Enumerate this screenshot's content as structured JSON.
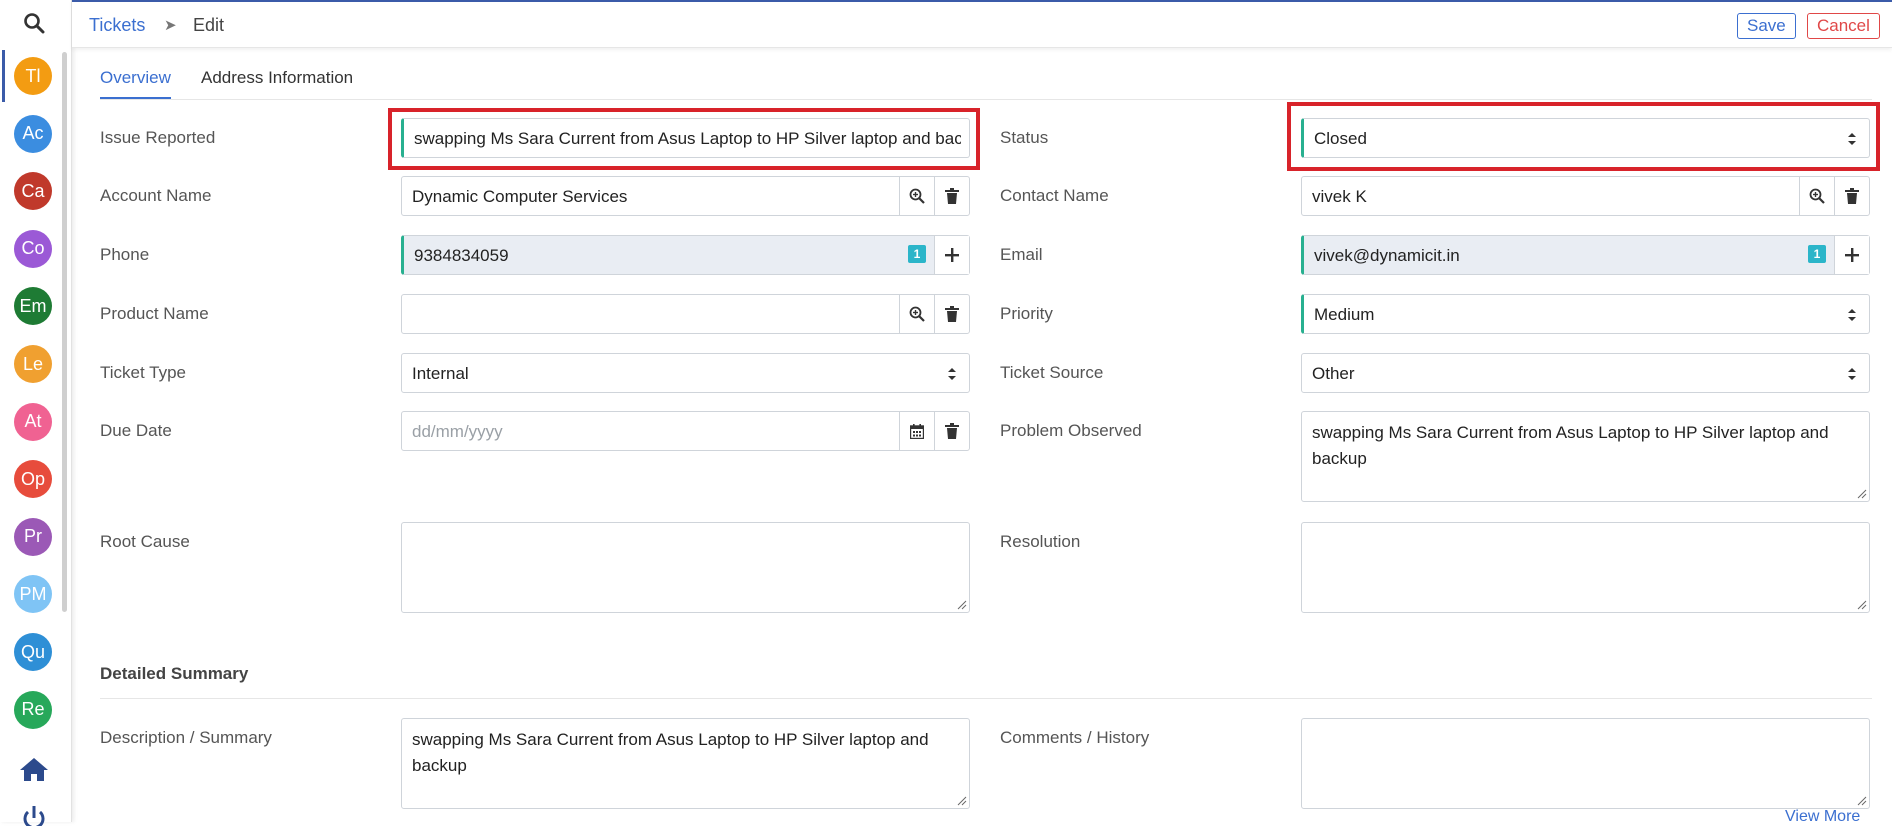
{
  "colors": {
    "accent": "#3b6fd0",
    "danger": "#e04848",
    "required": "#28b090",
    "highlight": "#d8232a"
  },
  "sidebar": {
    "avatars": [
      {
        "initials": "Tl",
        "color": "#f39c12"
      },
      {
        "initials": "Ac",
        "color": "#3b8de0"
      },
      {
        "initials": "Ca",
        "color": "#c0392b"
      },
      {
        "initials": "Co",
        "color": "#9b59d6"
      },
      {
        "initials": "Em",
        "color": "#1e7b34"
      },
      {
        "initials": "Le",
        "color": "#f0a030"
      },
      {
        "initials": "At",
        "color": "#f06292"
      },
      {
        "initials": "Op",
        "color": "#e74c3c"
      },
      {
        "initials": "Pr",
        "color": "#9b59b6"
      },
      {
        "initials": "PM",
        "color": "#7fc4f5"
      },
      {
        "initials": "Qu",
        "color": "#2e8fd6"
      },
      {
        "initials": "Re",
        "color": "#27a85a"
      }
    ]
  },
  "header": {
    "breadcrumb_link": "Tickets",
    "breadcrumb_current": "Edit",
    "save_label": "Save",
    "cancel_label": "Cancel"
  },
  "tabs": [
    "Overview",
    "Address Information"
  ],
  "form": {
    "issue_reported": {
      "label": "Issue Reported",
      "value": "swapping Ms Sara Current from Asus Laptop to HP Silver laptop and backup"
    },
    "status": {
      "label": "Status",
      "value": "Closed"
    },
    "account_name": {
      "label": "Account Name",
      "value": "Dynamic Computer Services"
    },
    "contact_name": {
      "label": "Contact Name",
      "value": "vivek K"
    },
    "phone": {
      "label": "Phone",
      "value": "9384834059",
      "count": "1"
    },
    "email": {
      "label": "Email",
      "value": "vivek@dynamicit.in",
      "count": "1"
    },
    "product_name": {
      "label": "Product Name",
      "value": ""
    },
    "priority": {
      "label": "Priority",
      "value": "Medium"
    },
    "ticket_type": {
      "label": "Ticket Type",
      "value": "Internal"
    },
    "ticket_source": {
      "label": "Ticket Source",
      "value": "Other"
    },
    "due_date": {
      "label": "Due Date",
      "placeholder": "dd/mm/yyyy"
    },
    "problem_observed": {
      "label": "Problem Observed",
      "value": "swapping Ms Sara Current from Asus Laptop to HP Silver laptop and backup"
    },
    "root_cause": {
      "label": "Root Cause",
      "value": ""
    },
    "resolution": {
      "label": "Resolution",
      "value": ""
    }
  },
  "detailed_summary": {
    "title": "Detailed Summary",
    "description": {
      "label": "Description / Summary",
      "value": "swapping Ms Sara Current from Asus Laptop to HP Silver laptop and backup"
    },
    "comments": {
      "label": "Comments / History",
      "value": ""
    },
    "view_more": "View More"
  }
}
